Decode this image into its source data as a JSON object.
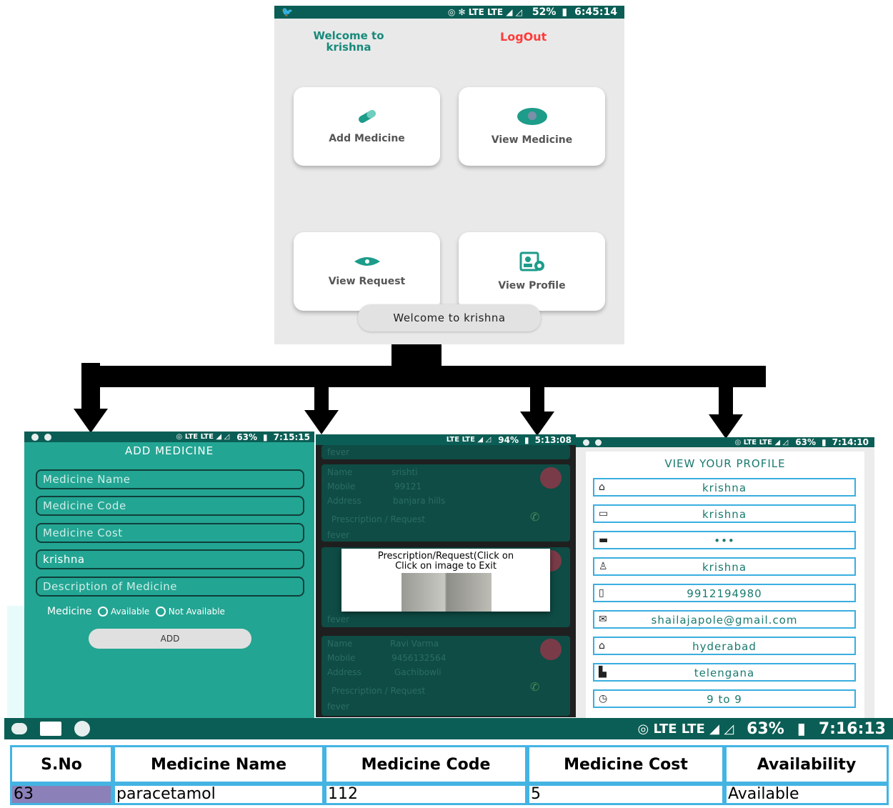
{
  "home": {
    "status_time": "6:45:14",
    "status_battery": "52%",
    "welcome_label": "Welcome to krishna",
    "logout_label": "LogOut",
    "tiles": {
      "add_medicine": "Add Medicine",
      "view_medicine": "View Medicine",
      "view_request": "View Request",
      "view_profile": "View Profile"
    },
    "toast": "Welcome to krishna"
  },
  "add_medicine": {
    "status_battery": "63%",
    "status_time": "7:15:15",
    "title": "ADD MEDICINE",
    "fields": {
      "name": "Medicine Name",
      "code": "Medicine Code",
      "cost": "Medicine Cost",
      "owner": "krishna",
      "description": "Description of Medicine"
    },
    "radio_label": "Medicine",
    "option_available": "Available",
    "option_not_available": "Not Available",
    "add_button": "ADD"
  },
  "requests": {
    "status_battery": "94%",
    "status_time": "5:13:08",
    "field_labels": {
      "name": "Name",
      "mobile": "Mobile",
      "address": "Address",
      "prescription": "Prescription / Request"
    },
    "top_note": "fever",
    "cards": [
      {
        "name": "srishti",
        "mobile": "99121",
        "address": "banjara hills",
        "note": "fever"
      },
      {
        "note": "fever"
      },
      {
        "name": "Ravi Varma",
        "mobile": "9456132564",
        "address": "Gachibowli",
        "note": "fever"
      }
    ],
    "dialog_title": "Prescription/Request(Click on",
    "dialog_subtitle": "Click on image to Exit"
  },
  "profile": {
    "status_battery": "63%",
    "status_time": "7:14:10",
    "title": "VIEW YOUR PROFILE",
    "fields": [
      "krishna",
      "krishna",
      "•••",
      "krishna",
      "9912194980",
      "shailajapole@gmail.com",
      "hyderabad",
      "telengana",
      "9 to 9"
    ]
  },
  "table_screen": {
    "status_battery": "63%",
    "status_time": "7:16:13",
    "headers": [
      "S.No",
      "Medicine Name",
      "Medicine Code",
      "Medicine Cost",
      "Availability"
    ],
    "rows": [
      [
        "63",
        "paracetamol",
        "112",
        "5",
        "Available"
      ]
    ]
  }
}
